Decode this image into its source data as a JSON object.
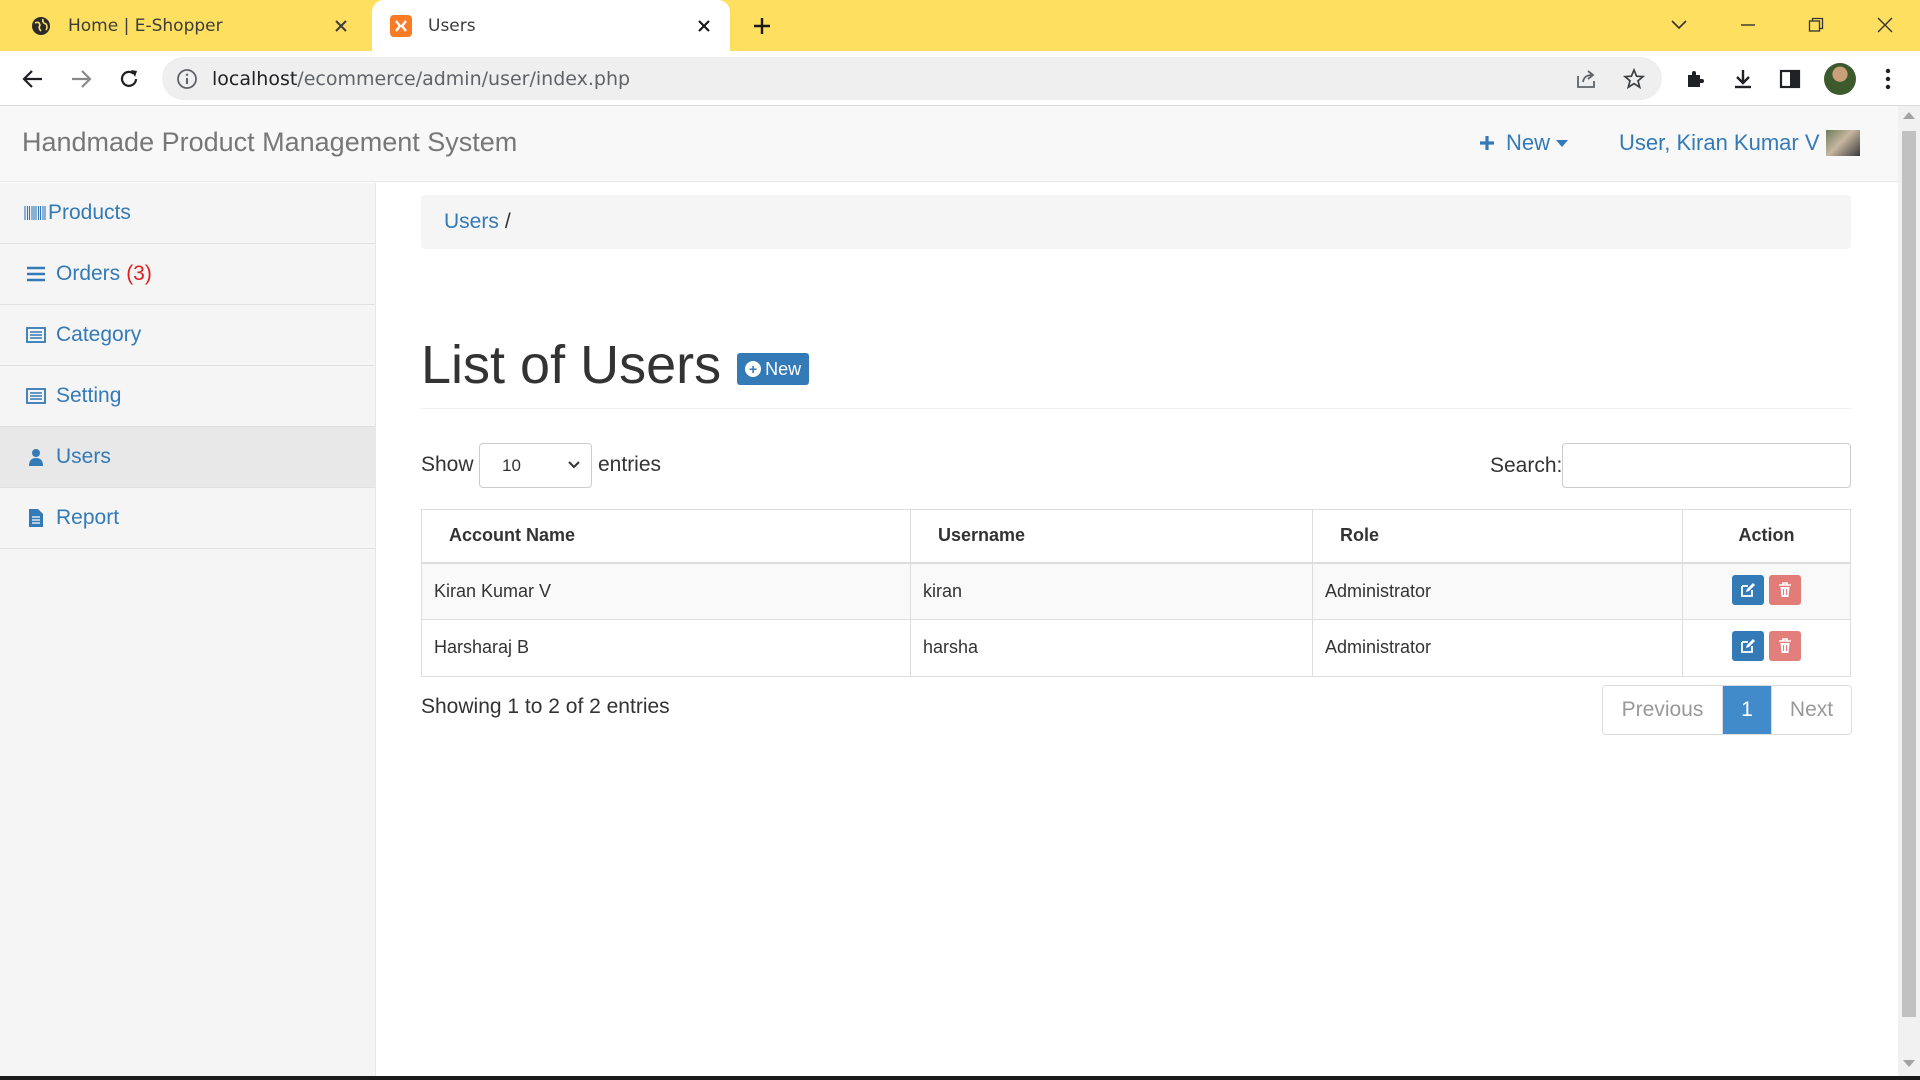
{
  "browser": {
    "tabs": [
      {
        "title": "Home | E-Shopper",
        "icon": "globe-icon",
        "active": false
      },
      {
        "title": "Users",
        "icon": "xampp-icon",
        "active": true
      }
    ],
    "url_host": "localhost",
    "url_path": "/ecommerce/admin/user/index.php"
  },
  "navbar": {
    "brand": "Handmade Product Management System",
    "new_label": "New",
    "user_label": "User, Kiran Kumar V"
  },
  "sidebar": {
    "items": [
      {
        "label": "Products",
        "icon": "barcode-icon"
      },
      {
        "label": "Orders",
        "count": "(3)",
        "icon": "list-icon"
      },
      {
        "label": "Category",
        "icon": "list-alt-icon"
      },
      {
        "label": "Setting",
        "icon": "list-alt-icon"
      },
      {
        "label": "Users",
        "icon": "user-icon",
        "active": true
      },
      {
        "label": "Report",
        "icon": "file-icon"
      }
    ]
  },
  "breadcrumb": {
    "link": "Users",
    "separator": "/"
  },
  "page": {
    "title": "List of Users",
    "new_button": "New"
  },
  "table_controls": {
    "show_label": "Show",
    "page_length": "10",
    "entries_label": "entries",
    "search_label": "Search:",
    "search_value": ""
  },
  "table": {
    "columns": [
      "Account Name",
      "Username",
      "Role",
      "Action"
    ],
    "rows": [
      {
        "account_name": "Kiran Kumar V",
        "username": "kiran",
        "role": "Administrator"
      },
      {
        "account_name": "Harsharaj B",
        "username": "harsha",
        "role": "Administrator"
      }
    ]
  },
  "footer": {
    "info": "Showing 1 to 2 of 2 entries",
    "previous": "Previous",
    "current_page": "1",
    "next": "Next"
  },
  "colors": {
    "accent": "#337ab7",
    "tabstrip": "#fedf5f",
    "danger": "#d9534f",
    "badge": "#e02020"
  }
}
